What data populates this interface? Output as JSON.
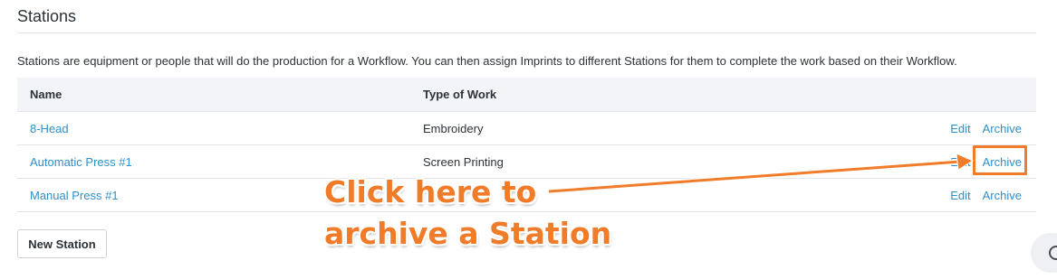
{
  "page": {
    "title": "Stations",
    "description": "Stations are equipment or people that will do the production for a Workflow. You can then assign Imprints to different Stations for them to complete the work based on their Workflow."
  },
  "table": {
    "headers": {
      "name": "Name",
      "type_of_work": "Type of Work"
    },
    "rows": [
      {
        "name": "8-Head",
        "type_of_work": "Embroidery",
        "edit": "Edit",
        "archive": "Archive"
      },
      {
        "name": "Automatic Press #1",
        "type_of_work": "Screen Printing",
        "edit": "Edit",
        "archive": "Archive"
      },
      {
        "name": "Manual Press #1",
        "type_of_work": "",
        "edit": "Edit",
        "archive": "Archive"
      }
    ]
  },
  "actions": {
    "new_station": "New Station"
  },
  "annotation": {
    "line1": "Click here to",
    "line2": "archive a Station",
    "color": "#f07b29"
  },
  "icons": {
    "help": "help-circle-icon"
  }
}
